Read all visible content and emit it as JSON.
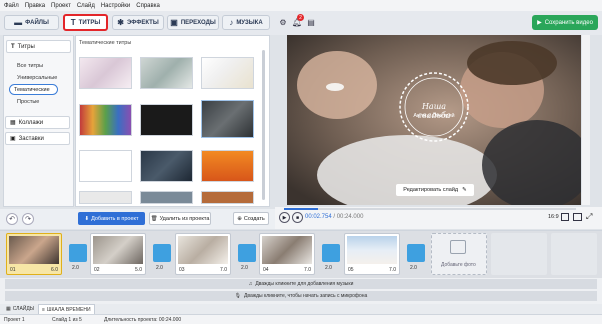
{
  "menu": [
    "Файл",
    "Правка",
    "Проект",
    "Слайд",
    "Настройки",
    "Справка"
  ],
  "tabs": [
    {
      "label": "ФАЙЛЫ",
      "icon": "folder-icon"
    },
    {
      "label": "ТИТРЫ",
      "icon": "text-t-icon",
      "active": true
    },
    {
      "label": "ЭФФЕКТЫ",
      "icon": "effects-icon"
    },
    {
      "label": "ПЕРЕХОДЫ",
      "icon": "transitions-icon"
    },
    {
      "label": "МУЗЫКА",
      "icon": "music-note-icon"
    }
  ],
  "toolbar": {
    "notification_count": "2",
    "save_label": "Сохранить видео"
  },
  "left_panel": {
    "titles_header": "Титры",
    "sub_items": [
      "Все титры",
      "Универсальные",
      "Тематические",
      "Простые"
    ],
    "collages_header": "Коллажи",
    "screensavers_header": "Заставки"
  },
  "content": {
    "title": "Тематические титры"
  },
  "left_actions": {
    "add_label": "Добавить в проект",
    "delete_label": "Удалить из проекта",
    "create_label": "Создать"
  },
  "preview": {
    "caption_title": "Наша свадьба",
    "caption_names": "Анна и Дмитрий",
    "edit_label": "Редактировать слайд"
  },
  "player": {
    "current_time": "00:02.754",
    "total_time": "00:24.000",
    "aspect": "16:9",
    "progress": 0.115
  },
  "timeline": {
    "clips": [
      {
        "num": "01",
        "duration": "6.0"
      },
      {
        "num": "02",
        "duration": "5.0"
      },
      {
        "num": "03",
        "duration": "7.0"
      },
      {
        "num": "04",
        "duration": "7.0"
      },
      {
        "num": "05",
        "duration": "7.0"
      }
    ],
    "transitions": [
      "2.0",
      "2.0",
      "2.0",
      "2.0",
      "2.0"
    ],
    "add_photo_label": "Добавьте фото",
    "music_track": "Дважды кликните для добавления музыки",
    "mic_track": "Дважды кликните, чтобы начать запись с микрофона"
  },
  "bottom_tabs": [
    "СЛАЙДЫ",
    "ШКАЛА ВРЕМЕНИ"
  ],
  "status": {
    "project": "Проект 1",
    "slide": "Слайд 1 из 5",
    "duration": "Длительность проекта: 00:24.000"
  }
}
